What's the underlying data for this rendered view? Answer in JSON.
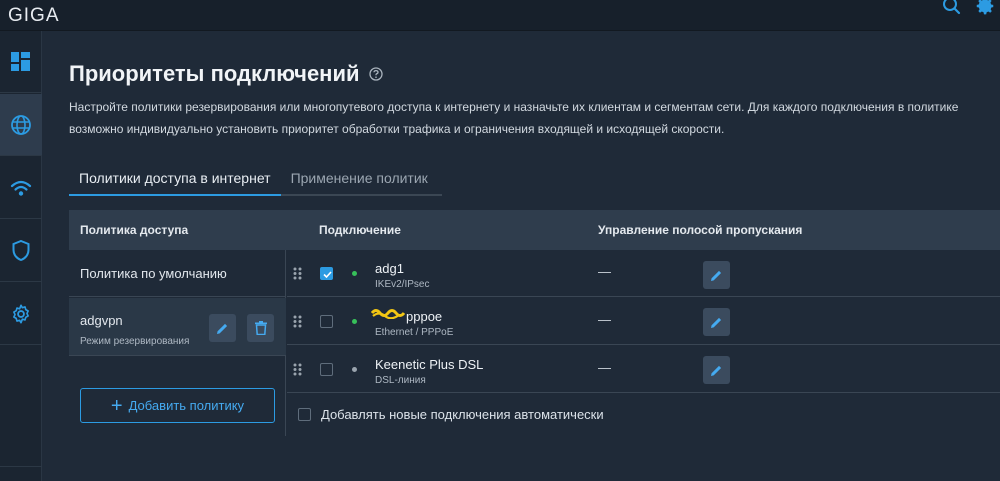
{
  "app": {
    "logo": "GIGA"
  },
  "topbar": {
    "icons": [
      "search-icon",
      "gear-icon"
    ]
  },
  "sidebar": {
    "items": [
      {
        "icon": "dashboard-icon",
        "active": false
      },
      {
        "icon": "globe-icon",
        "active": true
      },
      {
        "icon": "wifi-icon",
        "active": false
      },
      {
        "icon": "shield-icon",
        "active": false
      },
      {
        "icon": "gear-icon",
        "active": false
      }
    ]
  },
  "page": {
    "title": "Приоритеты подключений",
    "description": "Настройте политики резервирования или многопутевого доступа к интернету и назначьте их клиентам и сегментам сети. Для каждого подключения в политике возможно индивидуально установить приоритет обработки трафика и ограничения входящей и исходящей скорости."
  },
  "tabs": [
    {
      "label": "Политики доступа в интернет",
      "active": true
    },
    {
      "label": "Применение политик",
      "active": false
    }
  ],
  "table": {
    "headers": {
      "policy": "Политика доступа",
      "connection": "Подключение",
      "bandwidth": "Управление полосой пропускания"
    }
  },
  "policies": [
    {
      "name": "Политика по умолчанию",
      "mode": ""
    },
    {
      "name": "adgvpn",
      "mode": "Режим резервирования"
    }
  ],
  "add_policy_label": "Добавить политику",
  "connections": [
    {
      "name": "adg1",
      "type": "IKEv2/IPsec",
      "checked": true,
      "status_color": "#37c05a",
      "bandwidth": "—"
    },
    {
      "name": "pppoe",
      "type": "Ethernet / PPPoE",
      "checked": false,
      "status_color": "#37c05a",
      "bandwidth": "—"
    },
    {
      "name": "Keenetic Plus DSL",
      "type": "DSL-линия",
      "checked": false,
      "status_color": "#9aa4ae",
      "bandwidth": "—"
    }
  ],
  "auto_add_label": "Добавлять новые подключения автоматически",
  "colors": {
    "accent": "#2c9be2",
    "background": "#1f2a38",
    "header_bg": "#2f3d4d",
    "online": "#37c05a"
  }
}
